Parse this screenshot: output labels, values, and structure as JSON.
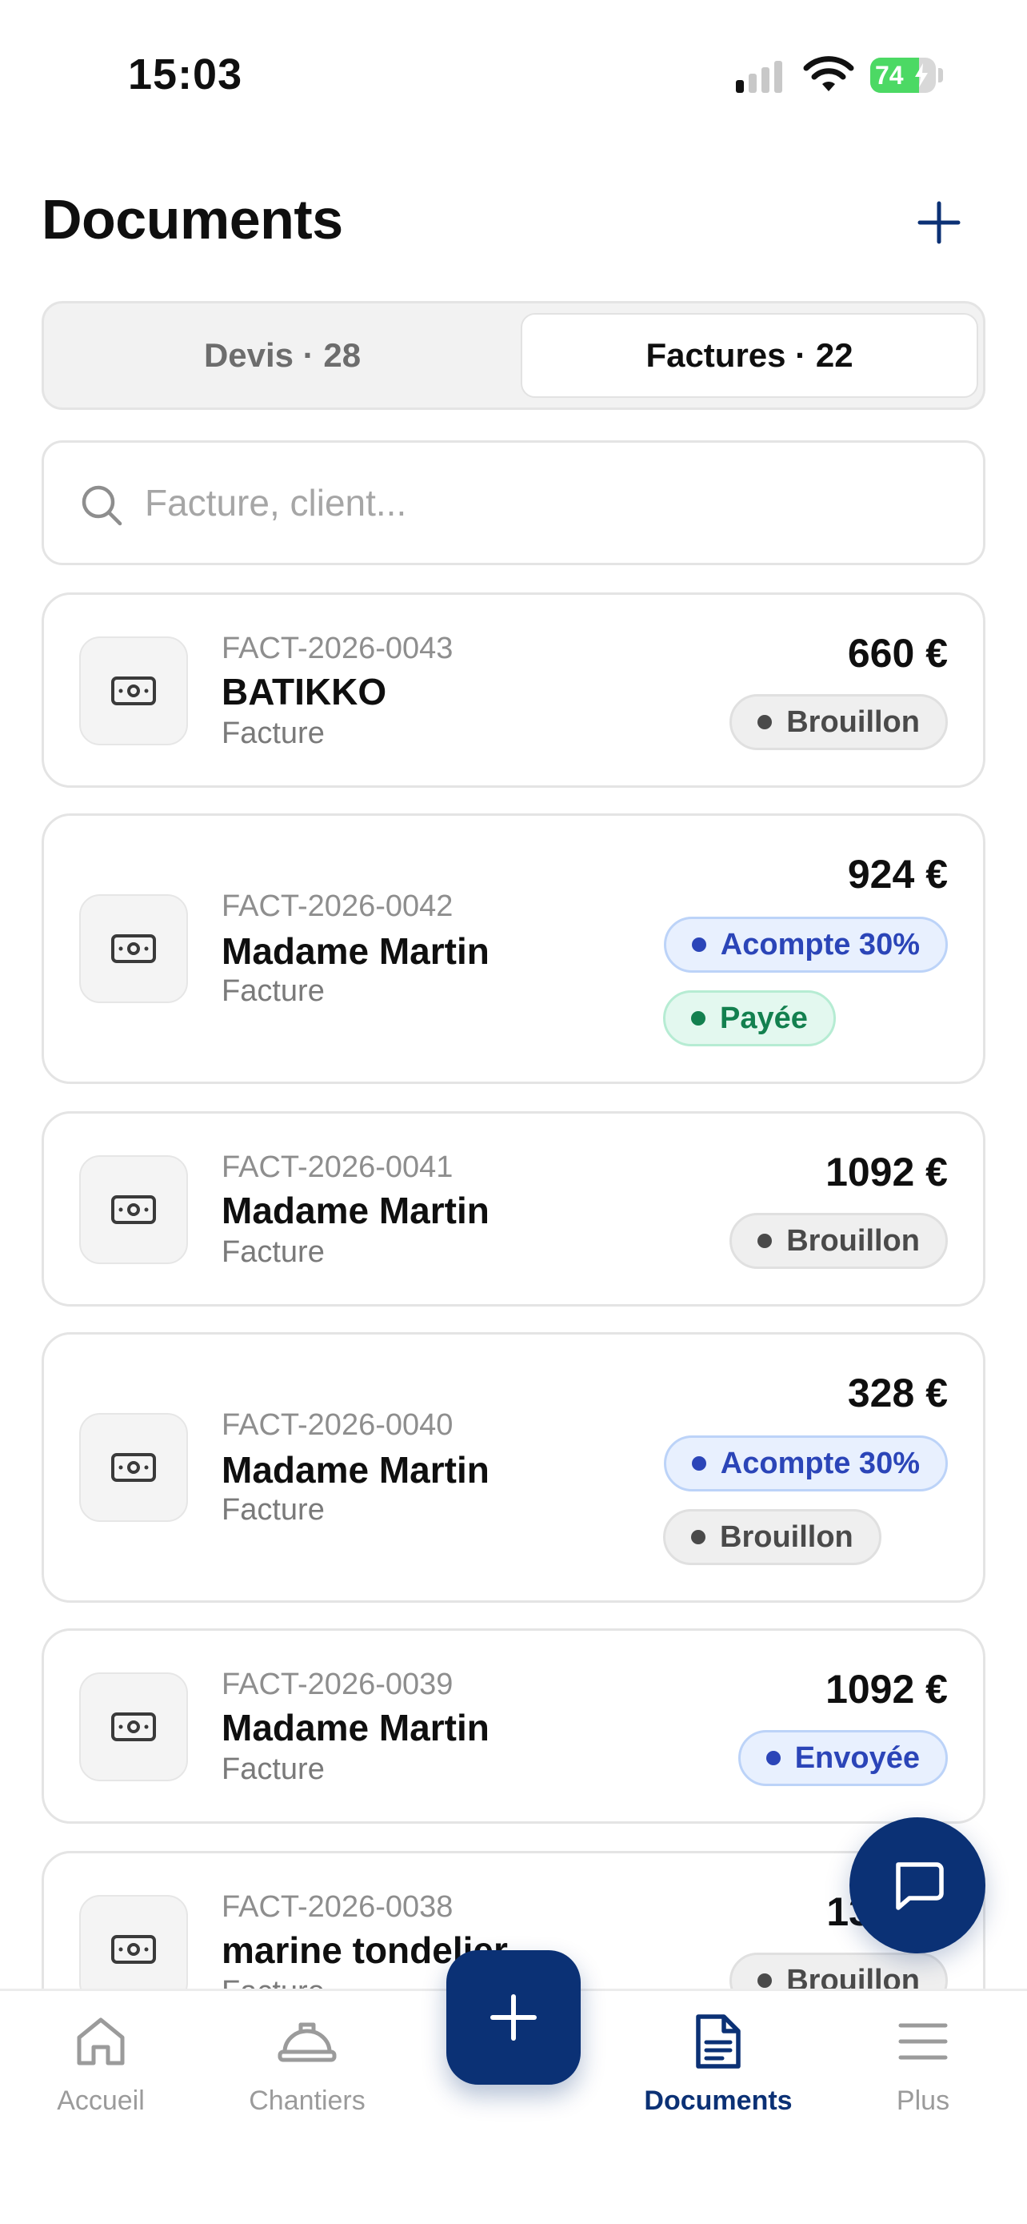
{
  "status_bar": {
    "time": "15:03",
    "battery": "74",
    "battery_level": 0.74
  },
  "header": {
    "title": "Documents",
    "add_icon": "plus-icon"
  },
  "segmented": {
    "devis_label": "Devis · 28",
    "factures_label": "Factures · 22",
    "selected": "factures"
  },
  "search": {
    "placeholder": "Facture, client...",
    "value": ""
  },
  "documents": [
    {
      "ref": "FACT-2026-0043",
      "client": "BATIKKO",
      "type": "Facture",
      "amount": "660 €",
      "badges": [
        {
          "label": "Brouillon",
          "tone": "grey"
        }
      ]
    },
    {
      "ref": "FACT-2026-0042",
      "client": "Madame Martin",
      "type": "Facture",
      "amount": "924 €",
      "badges": [
        {
          "label": "Acompte 30%",
          "tone": "blue"
        },
        {
          "label": "Payée",
          "tone": "green"
        }
      ]
    },
    {
      "ref": "FACT-2026-0041",
      "client": "Madame Martin",
      "type": "Facture",
      "amount": "1092 €",
      "badges": [
        {
          "label": "Brouillon",
          "tone": "grey"
        }
      ]
    },
    {
      "ref": "FACT-2026-0040",
      "client": "Madame Martin",
      "type": "Facture",
      "amount": "328 €",
      "badges": [
        {
          "label": "Acompte 30%",
          "tone": "blue"
        },
        {
          "label": "Brouillon",
          "tone": "grey"
        }
      ]
    },
    {
      "ref": "FACT-2026-0039",
      "client": "Madame Martin",
      "type": "Facture",
      "amount": "1092 €",
      "badges": [
        {
          "label": "Envoyée",
          "tone": "blue"
        }
      ]
    },
    {
      "ref": "FACT-2026-0038",
      "client": "marine tondelier",
      "type": "Facture",
      "amount": "13",
      "badges": [
        {
          "label": "Brouillon",
          "tone": "grey"
        }
      ]
    }
  ],
  "tabs": [
    {
      "label": "Accueil",
      "icon": "home-icon"
    },
    {
      "label": "Chantiers",
      "icon": "hard-hat-icon"
    },
    {
      "label": "Documents",
      "icon": "document-icon",
      "active": true
    },
    {
      "label": "Plus",
      "icon": "menu-icon"
    }
  ],
  "colors": {
    "primary": "#0b3175",
    "badge_blue": "#2b45b8",
    "badge_green": "#13804f",
    "badge_grey": "#4a4a4a"
  }
}
